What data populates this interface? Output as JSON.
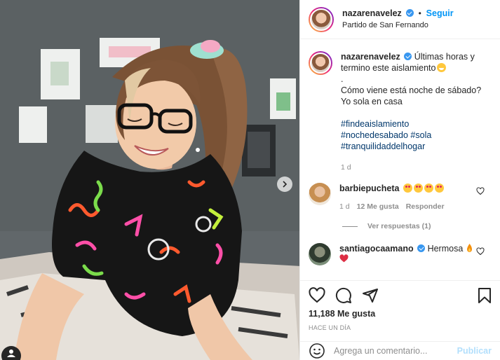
{
  "post": {
    "username": "nazarenavelez",
    "follow_label": "Seguir",
    "separator": "•",
    "location": "Partido de San Fernando",
    "caption_line1": "Últimas horas y termino este aislamiento",
    "caption_dot": ".",
    "caption_line2": "Cómo viene está noche de sábado?",
    "caption_line3": "Yo sola en casa",
    "hashtags": [
      "#findeaislamiento",
      "#nochedesabado",
      "#sola",
      "#tranquilidaddelhogar"
    ],
    "caption_age": "1 d"
  },
  "comments": [
    {
      "username": "barbiepucheta",
      "age": "1 d",
      "likes": "12 Me gusta",
      "reply": "Responder"
    },
    {
      "username": "santiagocaamano",
      "text": "Hermosa"
    }
  ],
  "view_replies": "Ver respuestas (1)",
  "actions": {
    "likes": "11,188 Me gusta",
    "time": "HACE UN DÍA"
  },
  "add_comment": {
    "placeholder": "Agrega un comentario...",
    "post_label": "Publicar"
  },
  "colors": {
    "link": "#0095f6",
    "hashtag": "#00376b",
    "muted": "#8e8e8e",
    "like_heart": "#ed4956"
  },
  "icons": [
    "verified-badge-icon",
    "heart-icon",
    "comment-icon",
    "share-icon",
    "bookmark-icon",
    "chevron-right-icon",
    "user-tag-icon"
  ]
}
